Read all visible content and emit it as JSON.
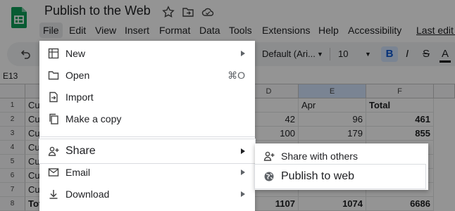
{
  "app": {
    "title": "Publish to the Web",
    "last_edit": "Last edit was"
  },
  "menubar": [
    {
      "label": "File"
    },
    {
      "label": "Edit"
    },
    {
      "label": "View"
    },
    {
      "label": "Insert"
    },
    {
      "label": "Format"
    },
    {
      "label": "Data"
    },
    {
      "label": "Tools"
    },
    {
      "label": "Extensions"
    },
    {
      "label": "Help"
    },
    {
      "label": "Accessibility"
    }
  ],
  "toolbar": {
    "font": "Default (Ari...",
    "font_size": "10",
    "bold": "B",
    "italic": "I",
    "strike": "S",
    "text_color": "A"
  },
  "formula_bar": {
    "cell_ref": "E13"
  },
  "grid": {
    "columns": [
      "D",
      "E",
      "F"
    ],
    "rows": [
      {
        "n": "1",
        "a": "Cu",
        "d": "",
        "e": "Apr",
        "f": "Total"
      },
      {
        "n": "2",
        "a": "Cu",
        "d": "42",
        "e": "96",
        "f": "461"
      },
      {
        "n": "3",
        "a": "Cu",
        "d": "100",
        "e": "179",
        "f": "855"
      },
      {
        "n": "4",
        "a": "Cu",
        "d": "",
        "e": "",
        "f": ""
      },
      {
        "n": "5",
        "a": "Cu",
        "d": "",
        "e": "",
        "f": ""
      },
      {
        "n": "6",
        "a": "Cu",
        "d": "",
        "e": "",
        "f": ""
      },
      {
        "n": "7",
        "a": "Cu",
        "d": "",
        "e": "",
        "f": ""
      },
      {
        "n": "8",
        "a": "Tota",
        "d": "1107",
        "e": "1074",
        "f": "6686"
      }
    ]
  },
  "file_menu": {
    "items": [
      {
        "label": "New",
        "shortcut": ""
      },
      {
        "label": "Open",
        "shortcut": "⌘O"
      },
      {
        "label": "Import",
        "shortcut": ""
      },
      {
        "label": "Make a copy",
        "shortcut": ""
      },
      {
        "label": "Share",
        "shortcut": ""
      },
      {
        "label": "Email",
        "shortcut": ""
      },
      {
        "label": "Download",
        "shortcut": ""
      }
    ]
  },
  "share_submenu": {
    "items": [
      {
        "label": "Share with others"
      },
      {
        "label": "Publish to web"
      }
    ]
  },
  "colors": {
    "sheets_green": "#0f9d58",
    "dim_overlay": "rgba(0,0,0,0.42)",
    "bold_active": "#d3e3fd"
  }
}
